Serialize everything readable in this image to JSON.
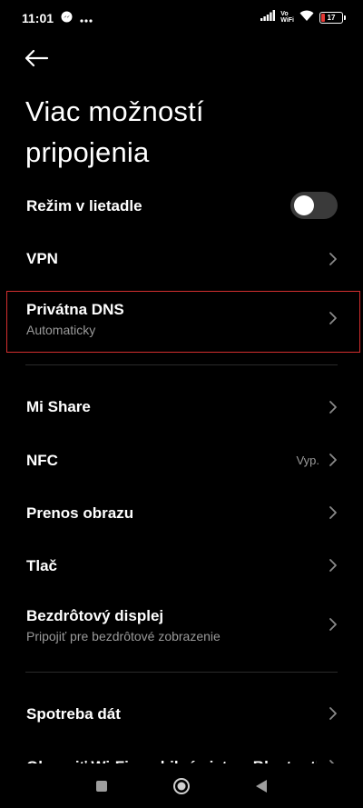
{
  "status_bar": {
    "time": "11:01",
    "network_label": "Vo\nWiFi",
    "battery_level": "17",
    "battery_color": "#e53935"
  },
  "header": {
    "back_icon": "arrow-left-icon",
    "title": "Viac možností pripojenia"
  },
  "settings": {
    "airplane": {
      "label": "Režim v lietadle",
      "enabled": false
    },
    "vpn": {
      "label": "VPN"
    },
    "private_dns": {
      "label": "Privátna DNS",
      "sub": "Automaticky"
    },
    "mi_share": {
      "label": "Mi Share"
    },
    "nfc": {
      "label": "NFC",
      "value": "Vyp."
    },
    "casting": {
      "label": "Prenos obrazu"
    },
    "print": {
      "label": "Tlač"
    },
    "wireless_display": {
      "label": "Bezdrôtový displej",
      "sub": "Pripojiť pre bezdrôtové zobrazenie"
    },
    "data_usage": {
      "label": "Spotreba dát"
    },
    "reset": {
      "label": "Obnoviť Wi-Fi, mobilné siete a Bluetooth"
    }
  },
  "colors": {
    "background": "#000000",
    "secondary_text": "#9a9a9a",
    "highlight_border": "#d32f2f"
  },
  "nav_bar": {
    "recents_icon": "square-icon",
    "home_icon": "circle-icon",
    "back_icon": "triangle-back-icon"
  }
}
